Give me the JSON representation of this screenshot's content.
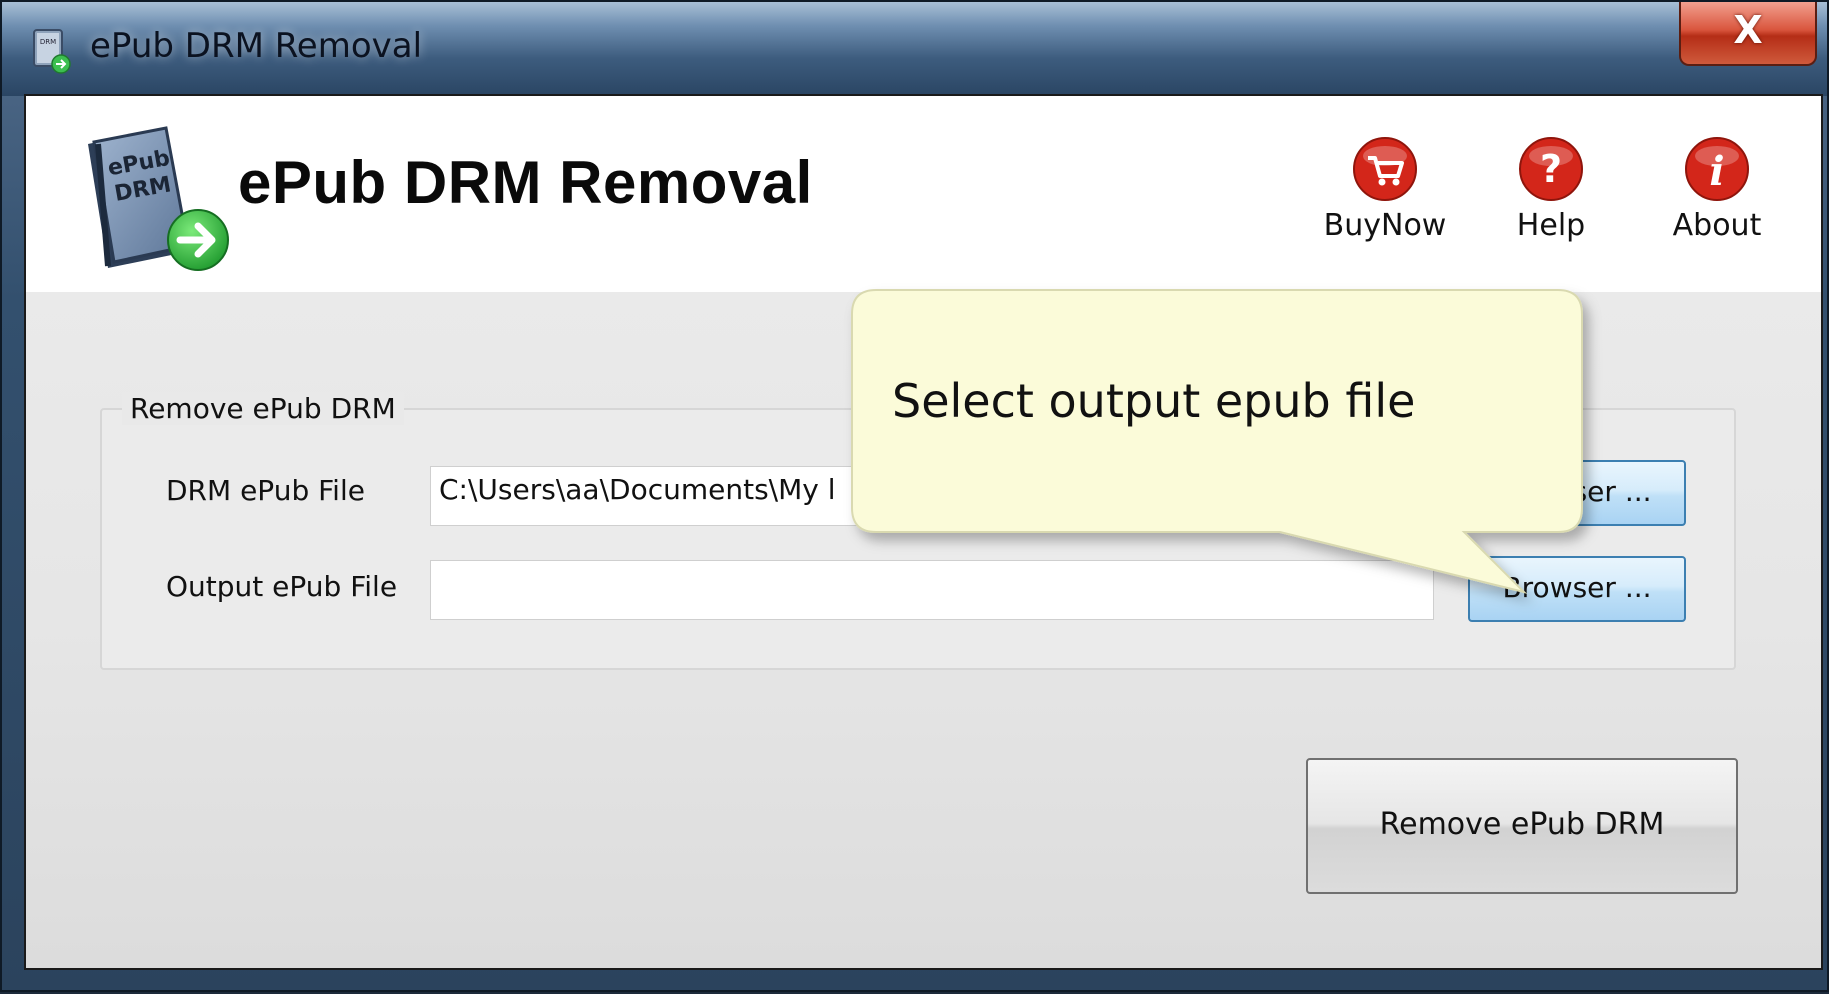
{
  "window": {
    "title": "ePub DRM Removal",
    "close_label": "X"
  },
  "header": {
    "logo_lines": [
      "ePub",
      "DRM"
    ],
    "app_title": "ePub DRM Removal",
    "tools": [
      {
        "label": "BuyNow",
        "icon": "cart-icon"
      },
      {
        "label": "Help",
        "icon": "question-icon"
      },
      {
        "label": "About",
        "icon": "info-icon"
      }
    ],
    "tool_icon_color": "#d3261a"
  },
  "group": {
    "legend": "Remove ePub DRM",
    "drm_label": "DRM ePub File",
    "drm_value": "C:\\Users\\aa\\Documents\\My l",
    "drm_browse_label": "Browser ...",
    "output_label": "Output ePub File",
    "output_value": "",
    "output_browse_label": "Browser ..."
  },
  "action": {
    "remove_label": "Remove ePub DRM"
  },
  "tooltip": {
    "text": "Select output epub file",
    "background": "#fbfbd9"
  }
}
